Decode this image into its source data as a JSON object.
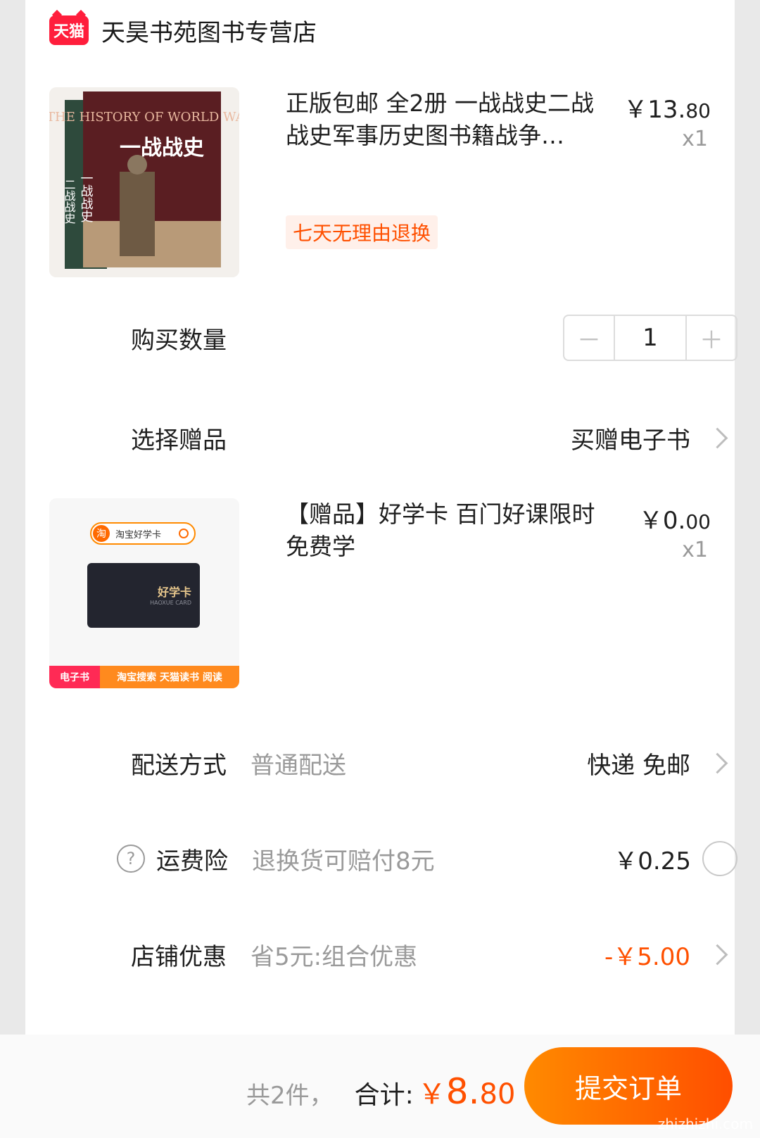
{
  "shop": {
    "logo_text": "天猫",
    "name": "天昊书苑图书专营店"
  },
  "product": {
    "title": "正版包邮 全2册 一战战史二战战史军事历史图书籍战争…",
    "price_main": "￥13.",
    "price_decimal": "80",
    "quantity": "x1",
    "tag": "七天无理由退换",
    "cover_text_1": "一战战史",
    "cover_text_2": "二战战史",
    "cover_en": "THE HISTORY OF WORLD WAR I"
  },
  "quantity_row": {
    "label": "购买数量",
    "minus": "－",
    "value": "1",
    "plus": "＋"
  },
  "gift_row": {
    "label": "选择赠品",
    "value": "买赠电子书"
  },
  "gift_item": {
    "title": "【赠品】好学卡 百门好课限时免费学",
    "price_main": "￥0.",
    "price_decimal": "00",
    "quantity": "x1",
    "search_badge": "淘",
    "search_text": "淘宝好学卡",
    "card_title": "好学卡",
    "card_sub": "HAOXUE CARD",
    "banner_left": "电子书",
    "banner_right": "淘宝搜索 天猫读书 阅读"
  },
  "delivery_row": {
    "label": "配送方式",
    "sub": "普通配送",
    "value": "快递 免邮"
  },
  "insurance_row": {
    "help_icon": "?",
    "label": "运费险",
    "sub": "退换货可赔付8元",
    "value": "￥0.25"
  },
  "promo_row": {
    "label": "店铺优惠",
    "sub": "省5元:组合优惠",
    "value": "-￥5.00"
  },
  "footer": {
    "count": "共2件，",
    "total_label": "合计:",
    "total_symbol": "￥",
    "total_int": "8.",
    "total_dec": "80",
    "submit": "提交订单",
    "watermark": "zhizhizhi.com"
  },
  "colors": {
    "accent": "#ff5000",
    "tmall_red": "#ff1e3c"
  }
}
